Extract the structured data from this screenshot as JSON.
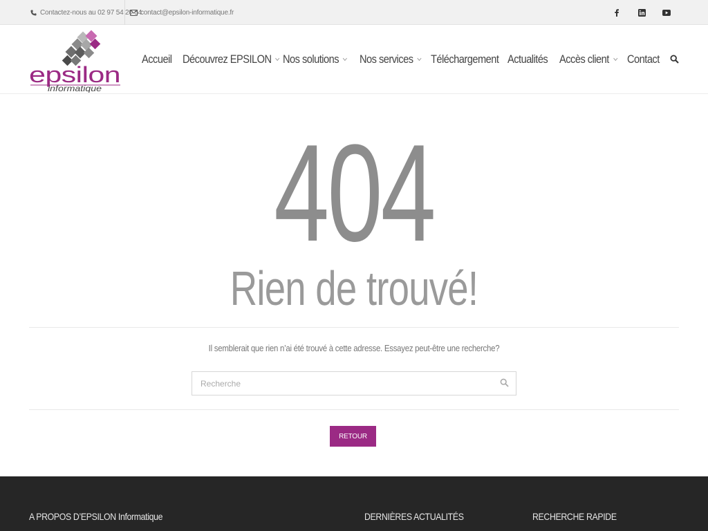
{
  "topbar": {
    "phone_text": "Contactez-nous au 02 97 54 20 54",
    "email_text": "contact@epsilon-informatique.fr",
    "social": [
      {
        "icon": "facebook-icon",
        "glyph": "f"
      },
      {
        "icon": "linkedin-icon",
        "glyph": "in"
      },
      {
        "icon": "youtube-icon",
        "glyph": "▶"
      }
    ]
  },
  "logo": {
    "name": "epsilon",
    "tagline": "informatique",
    "brand_color": "#9b2a84"
  },
  "nav": {
    "items": [
      {
        "label": "Accueil",
        "dropdown": false
      },
      {
        "label": "Découvrez EPSILON",
        "dropdown": true
      },
      {
        "label": "Nos solutions",
        "dropdown": true
      },
      {
        "label": "Nos services",
        "dropdown": true
      },
      {
        "label": "Téléchargement",
        "dropdown": false
      },
      {
        "label": "Actualités",
        "dropdown": false
      },
      {
        "label": "Accès client",
        "dropdown": true
      },
      {
        "label": "Contact",
        "dropdown": false
      }
    ],
    "search_icon": "search-icon"
  },
  "main": {
    "code": "404",
    "heading": "Rien de trouvé!",
    "hint": "Il semblerait que rien n’ai été trouvé à cette adresse. Essayez peut-être une recherche?",
    "search_placeholder": "Recherche",
    "back_button": "RETOUR"
  },
  "footer": {
    "headings": [
      "A PROPOS D’EPSILON Informatique",
      "DERNIÈRES ACTUALITÉS",
      "RECHERCHE RAPIDE"
    ]
  },
  "colors": {
    "accent": "#9b2a84",
    "footer_bg": "#262626",
    "topbar_bg": "#f1f1f1"
  }
}
